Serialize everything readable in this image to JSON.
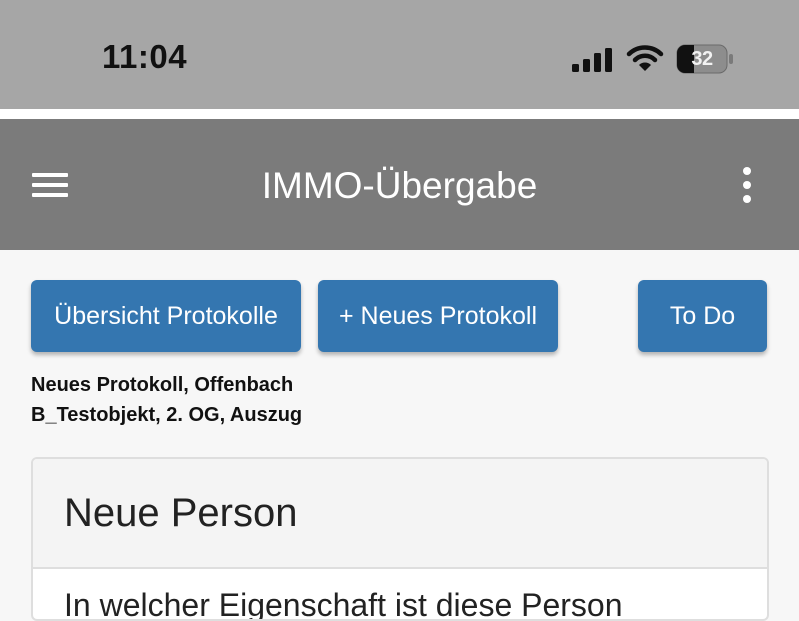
{
  "status_bar": {
    "time": "11:04",
    "battery_level": "32",
    "icons": [
      "signal-icon",
      "wifi-icon",
      "battery-icon"
    ]
  },
  "app_bar": {
    "title": "IMMO-Übergabe",
    "icons": [
      "menu-icon",
      "more-vertical-icon"
    ]
  },
  "actions": {
    "overview_label": "Übersicht Protokolle",
    "new_protocol_label": "+ Neues Protokoll",
    "todo_label": "To Do"
  },
  "context": {
    "line1": "Neues Protokoll, Offenbach",
    "line2": "B_Testobjekt, 2. OG, Auszug"
  },
  "card": {
    "title": "Neue Person",
    "body_text": "In welcher Eigenschaft ist diese Person"
  },
  "colors": {
    "status_bar_bg": "#a6a6a6",
    "app_bar_bg": "#7b7b7b",
    "button_bg": "#3476b0",
    "page_bg": "#f7f7f7"
  }
}
